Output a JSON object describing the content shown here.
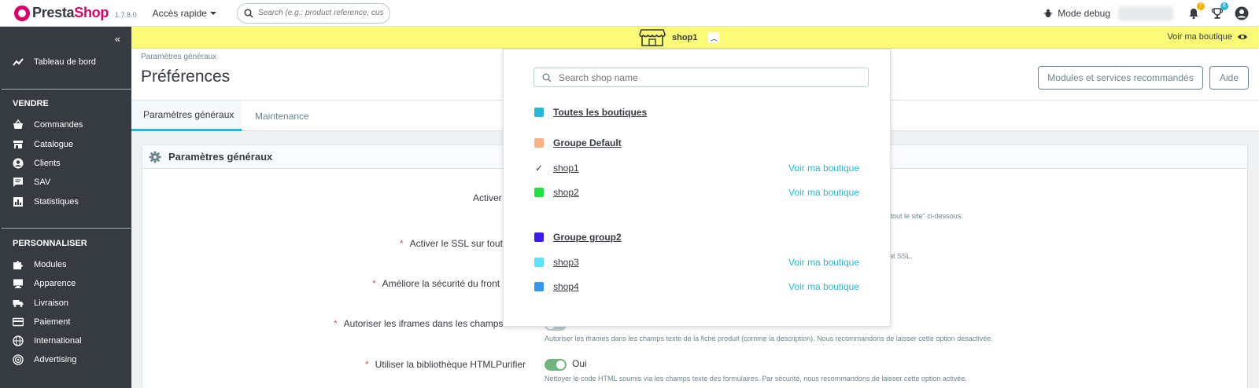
{
  "header": {
    "brand_pre": "Presta",
    "brand_post": "Shop",
    "version": "1.7.8.0",
    "quick_access": "Accès rapide",
    "search_placeholder": "Search (e.g.: product reference, custon",
    "debug_label": "Mode debug",
    "notif_orders_count": "7",
    "notif_customers_count": "6",
    "accent": "#df0067"
  },
  "sidebar": {
    "dashboard": "Tableau de bord",
    "section_sell": "VENDRE",
    "sell_items": [
      "Commandes",
      "Catalogue",
      "Clients",
      "SAV",
      "Statistiques"
    ],
    "section_customize": "PERSONNALISER",
    "customize_items": [
      "Modules",
      "Apparence",
      "Livraison",
      "Paiement",
      "International",
      "Advertising"
    ]
  },
  "shopbar": {
    "shop_name": "shop1",
    "view_shop": "Voir ma boutique",
    "color": "#fbfb78"
  },
  "page": {
    "breadcrumb": "Paramètres généraux",
    "title": "Préférences",
    "btn_modules": "Modules et services recommandés",
    "btn_help": "Aide",
    "tabs": [
      "Paramètres généraux",
      "Maintenance"
    ],
    "card_title": "Paramètres généraux"
  },
  "form": {
    "row1_label": "Activer",
    "row1_help": "r, sur tout le site\" ci-dessous.",
    "row2_label": "Activer le SSL sur tout",
    "row2_help": "ificat SSL.",
    "row3_label": "Améliore la sécurité du front",
    "row4_label": "Autoriser les iframes dans les champs HTML",
    "row4_value": "Non",
    "row4_help": "Autoriser les iframes dans les champs texte de la fiche produit (comme la description). Nous recommandons de laisser cette option désactivée.",
    "row5_label": "Utiliser la bibliothèque HTMLPurifier",
    "row5_value": "Oui",
    "row5_help": "Nettoyer le code HTML soumis via les champs texte des formulaires. Par sécurité, nous recommandons de laisser cette option activée."
  },
  "dropdown": {
    "search_placeholder": "Search shop name",
    "all_shops": "Toutes les boutiques",
    "group_default": "Groupe Default",
    "group2": "Groupe group2",
    "shops": [
      "shop1",
      "shop2",
      "shop3",
      "shop4"
    ],
    "view_shop": "Voir ma boutique",
    "colors": {
      "all": "#25b9d7",
      "group_default": "#fbaf84",
      "shop2": "#1de33f",
      "group2": "#3f19f1",
      "shop3": "#5ce3f7",
      "shop4": "#3597ec"
    }
  }
}
